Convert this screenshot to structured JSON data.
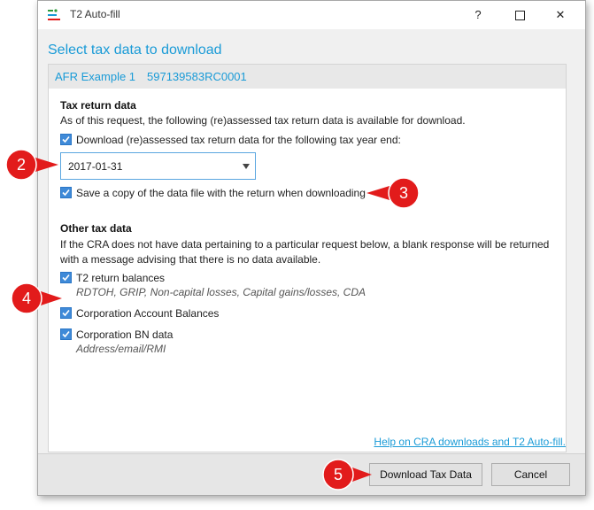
{
  "window": {
    "title": "T2 Auto-fill",
    "help_label": "?",
    "close_label": "✕"
  },
  "dialog": {
    "heading": "Select tax data to download",
    "entity_name": "AFR Example 1",
    "entity_bn": "597139583RC0001"
  },
  "tax_return": {
    "title": "Tax return data",
    "description": "As of this request, the following (re)assessed tax return data is available for download.",
    "download_label": "Download (re)assessed tax return data for the following tax year end:",
    "download_checked": true,
    "year_end_value": "2017-01-31",
    "save_copy_label": "Save a copy of the data file with the return when downloading",
    "save_copy_checked": true
  },
  "other": {
    "title": "Other tax data",
    "description_line1": "If the CRA does not have data pertaining to a particular request below, a blank response will be returned",
    "description_line2": "with a message advising that there is no data available.",
    "items": [
      {
        "label": "T2 return balances",
        "detail": "RDTOH, GRIP, Non-capital losses, Capital gains/losses, CDA",
        "checked": true
      },
      {
        "label": "Corporation Account Balances",
        "detail": "",
        "checked": true
      },
      {
        "label": "Corporation BN data",
        "detail": "Address/email/RMI",
        "checked": true
      }
    ]
  },
  "footer": {
    "help_link": "Help on CRA downloads and T2 Auto-fill.",
    "download_button": "Download Tax Data",
    "cancel_button": "Cancel"
  },
  "callouts": [
    "2",
    "3",
    "4",
    "5"
  ],
  "colors": {
    "accent": "#1a9bd7",
    "callout": "#e21b1b"
  }
}
